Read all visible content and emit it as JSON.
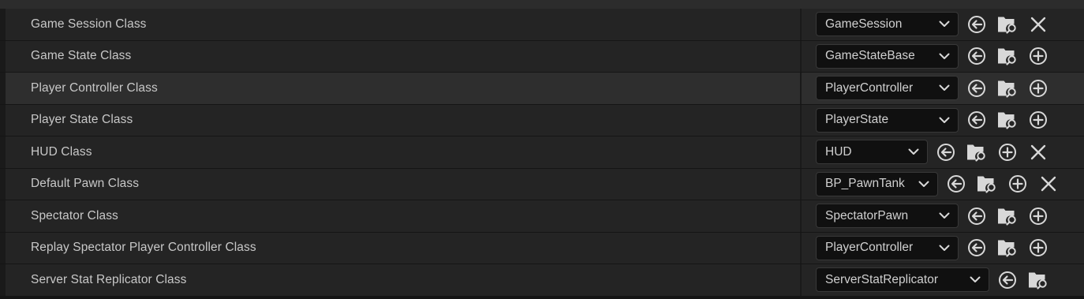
{
  "rows": [
    {
      "label": "Game Session Class",
      "value": "GameSession",
      "has_add": false,
      "has_clear": true
    },
    {
      "label": "Game State Class",
      "value": "GameStateBase",
      "has_add": true,
      "has_clear": false
    },
    {
      "label": "Player Controller Class",
      "value": "PlayerController",
      "has_add": true,
      "has_clear": false,
      "highlighted": true
    },
    {
      "label": "Player State Class",
      "value": "PlayerState",
      "has_add": true,
      "has_clear": false
    },
    {
      "label": "HUD Class",
      "value": "HUD",
      "has_add": true,
      "has_clear": true
    },
    {
      "label": "Default Pawn Class",
      "value": "BP_PawnTank",
      "has_add": true,
      "has_clear": true
    },
    {
      "label": "Spectator Class",
      "value": "SpectatorPawn",
      "has_add": true,
      "has_clear": false
    },
    {
      "label": "Replay Spectator Player Controller Class",
      "value": "PlayerController",
      "has_add": true,
      "has_clear": false
    },
    {
      "label": "Server Stat Replicator Class",
      "value": "ServerStatReplicator",
      "has_add": false,
      "has_clear": false
    }
  ],
  "icons": {
    "chevron": "chevron-down-icon",
    "use_selected": "use-selected-arrow-icon",
    "browse": "browse-folder-icon",
    "add": "add-plus-icon",
    "clear": "clear-x-icon"
  },
  "colors": {
    "row_bg": "#242424",
    "row_highlight_bg": "#2e2e2e",
    "combo_bg": "#101010",
    "text": "#c8c8c8",
    "icon": "#d8d8d8"
  }
}
